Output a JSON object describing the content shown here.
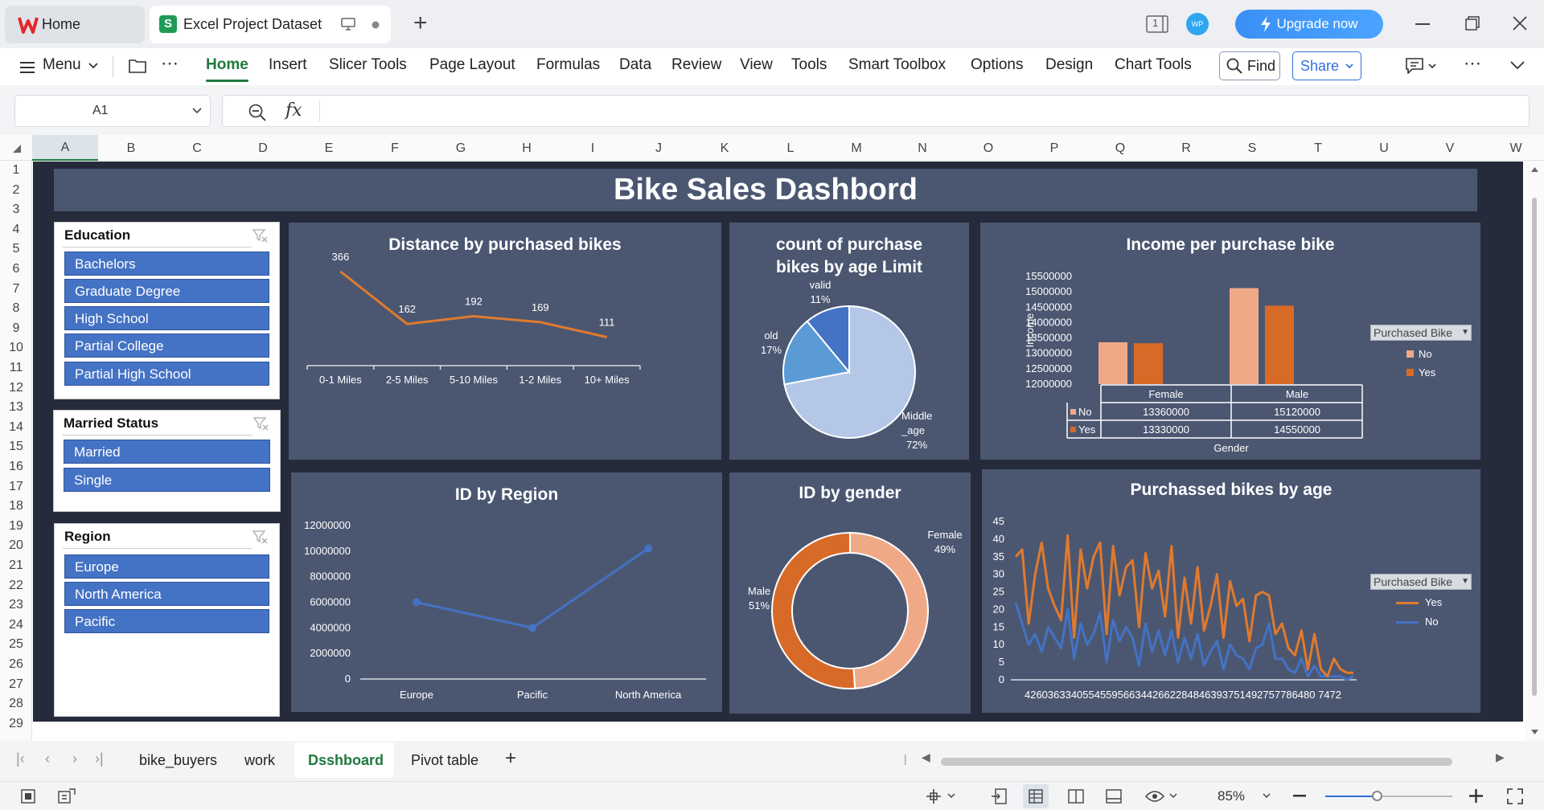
{
  "titlebar": {
    "home_tab": "Home",
    "doc_tab": "Excel Project Dataset",
    "upgrade": "Upgrade now",
    "avatar": "WP",
    "page_count": "1"
  },
  "menu": {
    "menu_label": "Menu",
    "items": [
      "Home",
      "Insert",
      "Slicer Tools",
      "Page Layout",
      "Formulas",
      "Data",
      "Review",
      "View",
      "Tools",
      "Smart Toolbox",
      "Options",
      "Design",
      "Chart Tools"
    ],
    "find": "Find",
    "share": "Share"
  },
  "formula": {
    "cell_ref": "A1",
    "fx": "fx",
    "content": ""
  },
  "columns": [
    "A",
    "B",
    "C",
    "D",
    "E",
    "F",
    "G",
    "H",
    "I",
    "J",
    "K",
    "L",
    "M",
    "N",
    "O",
    "P",
    "Q",
    "R",
    "S",
    "T",
    "U",
    "V",
    "W"
  ],
  "rows": [
    "1",
    "2",
    "3",
    "4",
    "5",
    "6",
    "7",
    "8",
    "9",
    "10",
    "11",
    "12",
    "13",
    "14",
    "15",
    "16",
    "17",
    "18",
    "19",
    "20",
    "21",
    "22",
    "23",
    "24",
    "25",
    "26",
    "27",
    "28",
    "29"
  ],
  "dashboard": {
    "title": "Bike Sales Dashbord",
    "slicers": {
      "education": {
        "header": "Education",
        "items": [
          "Bachelors",
          "Graduate Degree",
          "High School",
          "Partial College",
          "Partial High School"
        ]
      },
      "married": {
        "header": "Married Status",
        "items": [
          "Married",
          "Single"
        ]
      },
      "region": {
        "header": "Region",
        "items": [
          "Europe",
          "North America",
          "Pacific"
        ]
      }
    },
    "legend_dropdown": "Purchased Bike",
    "legend_no": "No",
    "legend_yes": "Yes",
    "colors": {
      "panel": "#4b5771",
      "orange": "#e07a2e",
      "blue": "#4472c4",
      "light_orange": "#f0a987",
      "dark_orange": "#d86a27",
      "slicer_button": "#4472c4"
    }
  },
  "chart_data": [
    {
      "type": "line",
      "title": "Distance by purchased bikes",
      "categories": [
        "0-1 Miles",
        "2-5 Miles",
        "5-10 Miles",
        "1-2 Miles",
        "10+ Miles"
      ],
      "values": [
        366,
        162,
        192,
        169,
        111
      ],
      "ylim": [
        0,
        400
      ]
    },
    {
      "type": "pie",
      "title": "count of purchase bikes by age Limit",
      "slices": [
        {
          "label": "Middle _age",
          "value": 72,
          "text": "72%"
        },
        {
          "label": "old",
          "value": 17,
          "text": "17%"
        },
        {
          "label": "valid",
          "value": 11,
          "text": "11%"
        }
      ]
    },
    {
      "type": "bar",
      "title": "Income per purchase bike",
      "ylabel": "Income",
      "xlabel": "Gender",
      "categories": [
        "Female",
        "Male"
      ],
      "ylim": [
        12000000,
        15500000
      ],
      "yticks": [
        "15500000",
        "15000000",
        "14500000",
        "14000000",
        "13500000",
        "13000000",
        "12500000",
        "12000000"
      ],
      "series": [
        {
          "name": "No",
          "values": [
            13360000,
            15120000
          ]
        },
        {
          "name": "Yes",
          "values": [
            13330000,
            14550000
          ]
        }
      ],
      "table_values": {
        "No": [
          "13360000",
          "15120000"
        ],
        "Yes": [
          "13330000",
          "14550000"
        ]
      }
    },
    {
      "type": "line",
      "title": "ID by Region",
      "categories": [
        "Europe",
        "Pacific",
        "North America"
      ],
      "values": [
        6000000,
        4000000,
        10200000
      ],
      "ylim": [
        0,
        12000000
      ],
      "yticks": [
        "12000000",
        "10000000",
        "8000000",
        "6000000",
        "4000000",
        "2000000",
        "0"
      ]
    },
    {
      "type": "pie",
      "title": "ID by gender",
      "donut": true,
      "slices": [
        {
          "label": "Female",
          "value": 49,
          "text": "49%"
        },
        {
          "label": "Male",
          "value": 51,
          "text": "51%"
        }
      ]
    },
    {
      "type": "line",
      "title": "Purchassed bikes by age",
      "ylim": [
        0,
        45
      ],
      "yticks": [
        "45",
        "40",
        "35",
        "30",
        "25",
        "20",
        "15",
        "10",
        "5",
        "0"
      ],
      "x_ticks_text": "42603633405545595663442662284846393751492757786480 7472",
      "series": [
        {
          "name": "Yes",
          "values": [
            35,
            37,
            16,
            30,
            39,
            26,
            21,
            17,
            41,
            12,
            37,
            26,
            35,
            39,
            13,
            38,
            24,
            32,
            34,
            15,
            36,
            26,
            31,
            18,
            38,
            12,
            29,
            16,
            32,
            14,
            21,
            30,
            12,
            28,
            21,
            23,
            11,
            24,
            25,
            24,
            13,
            16,
            9,
            7,
            14,
            3,
            13,
            3,
            1,
            6,
            3,
            2,
            2
          ]
        },
        {
          "name": "No",
          "values": [
            22,
            16,
            10,
            13,
            8,
            15,
            12,
            9,
            20,
            6,
            16,
            10,
            13,
            19,
            5,
            17,
            11,
            15,
            12,
            4,
            16,
            8,
            14,
            7,
            14,
            5,
            12,
            6,
            13,
            4,
            8,
            11,
            3,
            10,
            7,
            6,
            3,
            9,
            10,
            16,
            6,
            6,
            3,
            2,
            6,
            1,
            4,
            1,
            1,
            1,
            1,
            0,
            1
          ]
        }
      ]
    }
  ],
  "sheets": {
    "tabs": [
      "bike_buyers",
      "work",
      "Dsshboard",
      "Pivot table"
    ],
    "active": "Dsshboard"
  },
  "status": {
    "zoom": "85%"
  }
}
